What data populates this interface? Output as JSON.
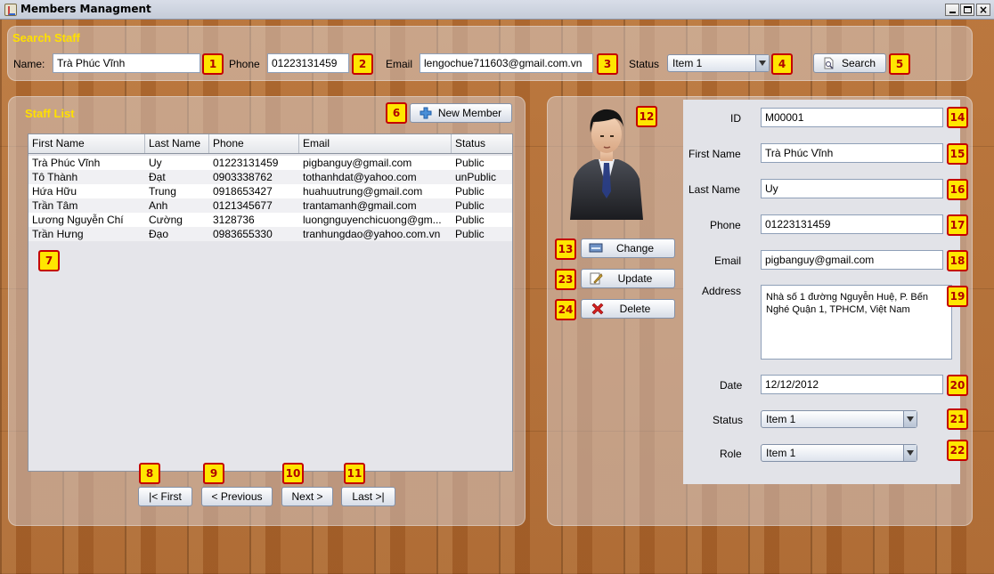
{
  "window": {
    "title": "Members Managment"
  },
  "search": {
    "title": "Search Staff",
    "name_label": "Name:",
    "name_value": "Trà Phúc Vĩnh",
    "phone_label": "Phone",
    "phone_value": "01223131459",
    "email_label": "Email",
    "email_value": "lengochue711603@gmail.com.vn",
    "status_label": "Status",
    "status_value": "Item 1",
    "search_button": "Search"
  },
  "staff_list": {
    "title": "Staff List",
    "new_member_button": "New Member",
    "columns": [
      "First Name",
      "Last Name",
      "Phone",
      "Email",
      "Status"
    ],
    "rows": [
      [
        "Trà Phúc Vĩnh",
        "Uy",
        "01223131459",
        "pigbanguy@gmail.com",
        "Public"
      ],
      [
        "Tô Thành",
        "Đạt",
        "0903338762",
        "tothanhdat@yahoo.com",
        "unPublic"
      ],
      [
        "Hứa Hữu",
        "Trung",
        "0918653427",
        "huahuutrung@gmail.com",
        "Public"
      ],
      [
        "Trần Tâm",
        "Anh",
        "0121345677",
        "trantamanh@gmail.com",
        "Public"
      ],
      [
        "Lương Nguyễn Chí",
        "Cường",
        "3128736",
        "luongnguyenchicuong@gm...",
        "Public"
      ],
      [
        "Trần Hưng",
        "Đạo",
        "0983655330",
        "tranhungdao@yahoo.com.vn",
        "Public"
      ]
    ],
    "pager": {
      "first": "|< First",
      "previous": "< Previous",
      "next": "Next >",
      "last": "Last >|"
    }
  },
  "detail": {
    "change_button": "Change",
    "update_button": "Update",
    "delete_button": "Delete",
    "id_label": "ID",
    "id_value": "M00001",
    "first_name_label": "First Name",
    "first_name_value": "Trà Phúc Vĩnh",
    "last_name_label": "Last Name",
    "last_name_value": "Uy",
    "phone_label": "Phone",
    "phone_value": "01223131459",
    "email_label": "Email",
    "email_value": "pigbanguy@gmail.com",
    "address_label": "Address",
    "address_value": "Nhà số 1 đường Nguyễn Huệ, P. Bến Nghé Quận 1, TPHCM, Việt Nam",
    "date_label": "Date",
    "date_value": "12/12/2012",
    "status_label": "Status",
    "status_value": "Item 1",
    "role_label": "Role",
    "role_value": "Item 1"
  },
  "badges": [
    "1",
    "2",
    "3",
    "4",
    "5",
    "6",
    "7",
    "8",
    "9",
    "10",
    "11",
    "12",
    "13",
    "14",
    "15",
    "16",
    "17",
    "18",
    "19",
    "20",
    "21",
    "22",
    "23",
    "24"
  ],
  "colors": {
    "section_title": "#ffe000",
    "badge_fill": "#ffe600",
    "badge_border": "#c40000"
  }
}
